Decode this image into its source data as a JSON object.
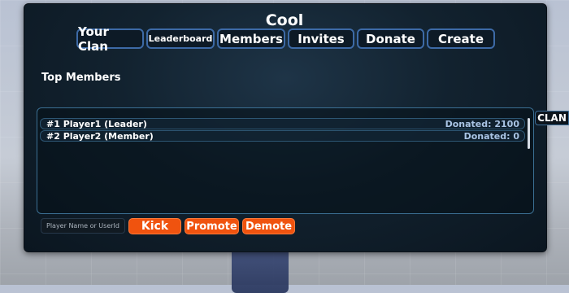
{
  "panel": {
    "title": "Cool"
  },
  "tabs": [
    {
      "label": "Your Clan"
    },
    {
      "label": "Leaderboard"
    },
    {
      "label": "Members"
    },
    {
      "label": "Invites"
    },
    {
      "label": "Donate"
    },
    {
      "label": "Create"
    }
  ],
  "section": {
    "title": "Top Members"
  },
  "members": [
    {
      "name": "#1  Player1  (Leader)",
      "donated": "Donated: 2100"
    },
    {
      "name": "#2  Player2  (Member)",
      "donated": "Donated: 0"
    }
  ],
  "sidebar": {
    "clan_button": "CLAN"
  },
  "input": {
    "placeholder": "Player Name or UserId",
    "value": ""
  },
  "actions": {
    "kick": "Kick",
    "promote": "Promote",
    "demote": "Demote"
  },
  "colors": {
    "panel_bg": "#12222f",
    "tab_border": "#3d6aa6",
    "action_orange": "#f0530f",
    "donated_text": "#a9c4e4"
  }
}
